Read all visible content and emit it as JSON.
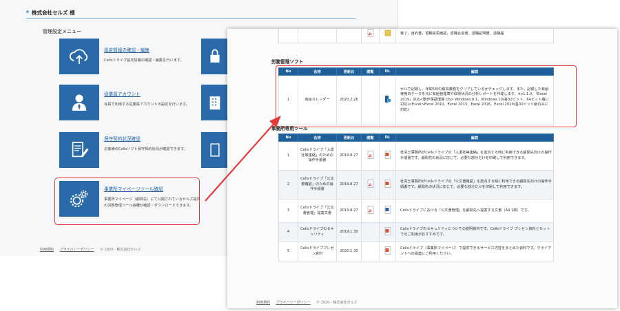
{
  "back": {
    "company": "株式会社セルズ 様",
    "menu_title": "管理設定メニュー",
    "entries": [
      {
        "title": "設定情報の確認・編集",
        "desc": "Cellsドライブ設定情報の確認・編集を行います。"
      },
      {
        "title": "従業員アカウント",
        "desc": "会員で利用する従業員アカウントの設定を行います。"
      },
      {
        "title": "保守契約状況確認",
        "desc": "お客様のCellsソフト保守契約状況が確認できます。"
      },
      {
        "title": "事業所マイページツール確認",
        "desc": "事業所マイページ（顧問先）にて公開されているセルズ提供の労務管理ツール各種が確認・ダウンロードできます。"
      }
    ],
    "footer": {
      "terms": "利用規約",
      "privacy": "プライバシーポリシー",
      "copyright": "© 2020 - 株式会社セルズ"
    }
  },
  "front": {
    "top_row_desc_line1": "奏了，自約書，退職意思確認，退職合意書，退職証明書，退職届",
    "section1_title": "労務管理ソフト",
    "section2_title": "事務所専用ツール",
    "headers": {
      "no": "No",
      "name": "名称",
      "date": "更新日",
      "view": "閲覧",
      "dl": "DL",
      "desc": "解説"
    },
    "table1": [
      {
        "no": "1",
        "name": "有給カレンダー",
        "date": "2020.2.26",
        "desc": "セルで記録し、年間5日の取得義務をクリアしているかチェックします。また、記録した有給使用日データを元に有給管理簿や取得状況の分析レポートを作成します。※v1.1.0、「Excel 2019」対応<動作保証環境 OS> Windows 8.1、Windows 10(各32ビット、64ビット版に対応)<Excel>Excel 2010、Excel 2013、Excel 2016、Excel 2019(各32ビット版のみに対応)"
      }
    ],
    "table2": [
      {
        "no": "1",
        "name": "Cellsドライブ「入退社等連絡」のための操作手順書",
        "date": "2019.8.27",
        "desc": "社労士事務所がCellsドライブの「入退社等連絡」を案内する時に利用できる顧問先向けの操作手順書です。顧問先の状況に応じて、必要な部分だけを印刷して利用できます。"
      },
      {
        "no": "2",
        "name": "Cellsドライブ「公文書確認」のための操作手順書",
        "date": "2019.8.27",
        "desc": "社労士事務所がCellsドライブの「公文書確認」を案内する時に利用できる顧問先向けの操作手順書です。顧問先の状況に応じて、必要な部分だけを印刷して利用できます。"
      },
      {
        "no": "3",
        "name": "Cellsドライブ「公文書管理」提案文書",
        "date": "2019.8.27",
        "desc": "Cellsドライブにおける「公文書管理」を顧問先へ提案する文書（A4 1枚）です。"
      },
      {
        "no": "4",
        "name": "Cellsドライブのセキュリティ",
        "date": "2019.1.30",
        "desc": "Cellsドライブのセキュリティについての説明資料です。Cellsドライブ プレゼン資料とセットでのご利用がおすすめです。"
      },
      {
        "no": "5",
        "name": "Cellsドライブプレゼン資料",
        "date": "2020.1.30",
        "desc": "Cellsドライブ（事業所マイページ）で提供できるサービス内容をまとめた資料です。クライアントへの提案にご利用ください。"
      }
    ],
    "footer": {
      "terms": "利用規約",
      "privacy": "プライバシーポリシー",
      "copyright": "© 2020 - 株式会社セルズ"
    }
  },
  "colors": {
    "tile": "#2b6aa8",
    "header": "#1f5f99",
    "highlight": "#e53935",
    "link": "#1d5fa0"
  }
}
